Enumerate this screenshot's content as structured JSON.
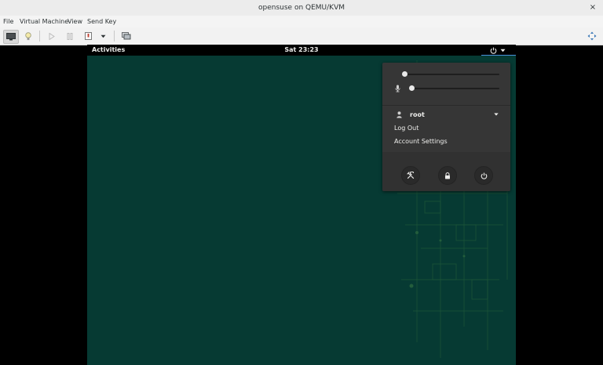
{
  "window": {
    "title": "opensuse on QEMU/KVM",
    "close_glyph": "×"
  },
  "menubar": {
    "items": [
      "File",
      "Virtual Machine",
      "View",
      "Send Key"
    ]
  },
  "toolbar": {
    "buttons": [
      {
        "icon": "monitor-icon",
        "active": true
      },
      {
        "icon": "lightbulb-icon"
      },
      {
        "icon": "play-icon"
      },
      {
        "icon": "pause-icon"
      },
      {
        "icon": "power-icon"
      },
      {
        "icon": "chevron-down-icon"
      },
      {
        "icon": "snapshot-icon"
      },
      {
        "icon": "fullscreen-icon"
      }
    ]
  },
  "guest": {
    "topbar": {
      "activities": "Activities",
      "clock": "Sat 23:23",
      "icons": [
        "power-icon",
        "chevron-down-icon"
      ]
    },
    "system_menu": {
      "volume_level": 0.0,
      "mic_level": 0.0,
      "user": "root",
      "items": [
        "Log Out",
        "Account Settings"
      ],
      "action_buttons": [
        "settings-icon",
        "lock-icon",
        "power-icon"
      ]
    }
  },
  "colors": {
    "desktop": "#063a33",
    "topbar": "#000000",
    "menu_bg": "#363636",
    "accent": "#4a90d9"
  }
}
